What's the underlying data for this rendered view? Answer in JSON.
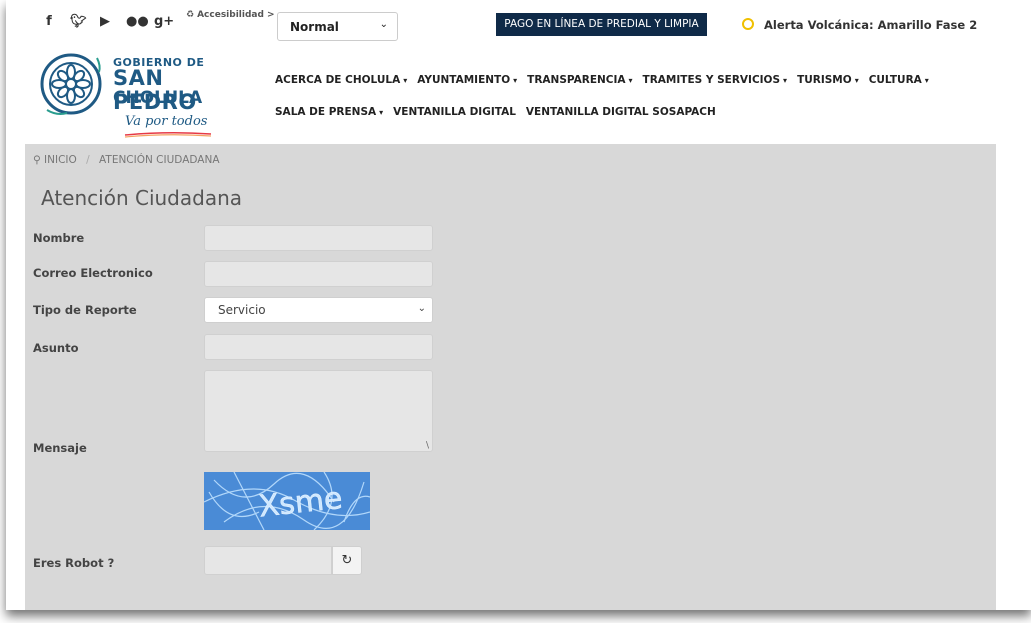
{
  "topbar": {
    "social_icons": [
      "facebook-icon",
      "twitter-icon",
      "youtube-icon",
      "flickr-icon",
      "google-plus-icon"
    ],
    "accessibility_label": "Accesibilidad >",
    "text_size_select": "Normal",
    "pago_button": "PAGO EN LÍNEA DE PREDIAL Y LIMPIA",
    "alerta_text": "Alerta Volcánica: Amarillo Fase 2",
    "alerta_color": "#f0c000"
  },
  "logo": {
    "line1": "GOBIERNO DE",
    "line2": "SAN PEDRO",
    "line3": "CHOLULA",
    "slogan": "Va por todos"
  },
  "nav": {
    "row1": [
      {
        "label": "ACERCA DE CHOLULA",
        "dropdown": true
      },
      {
        "label": "AYUNTAMIENTO",
        "dropdown": true
      },
      {
        "label": "TRANSPARENCIA",
        "dropdown": true
      },
      {
        "label": "TRAMITES Y SERVICIOS",
        "dropdown": true
      },
      {
        "label": "TURISMO",
        "dropdown": true
      },
      {
        "label": "CULTURA",
        "dropdown": true
      }
    ],
    "row2": [
      {
        "label": "SALA DE PRENSA",
        "dropdown": true
      },
      {
        "label": "VENTANILLA DIGITAL",
        "dropdown": false
      },
      {
        "label": "VENTANILLA DIGITAL SOSAPACH",
        "dropdown": false
      }
    ]
  },
  "breadcrumb": {
    "home": "INICIO",
    "current": "ATENCIÓN CIUDADANA"
  },
  "form": {
    "title": "Atención Ciudadana",
    "nombre_label": "Nombre",
    "correo_label": "Correo Electronico",
    "tipo_label": "Tipo de Reporte",
    "tipo_value": "Servicio",
    "asunto_label": "Asunto",
    "mensaje_label": "Mensaje",
    "robot_label": "Eres Robot ?",
    "captcha_text": "Xsme"
  },
  "colors": {
    "dark_navy": "#0f2a48",
    "brand_blue": "#1f5a84",
    "content_bg": "#d8d8d8"
  }
}
